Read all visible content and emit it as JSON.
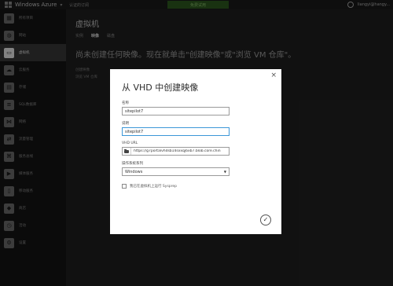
{
  "topbar": {
    "brand": "Windows Azure",
    "subscription": "认证的订阅",
    "credit": "免费试用",
    "user_email": "liangyi@hangy..."
  },
  "sidebar": {
    "items": [
      {
        "label": "所有项目",
        "icon": "grid-icon",
        "active": false
      },
      {
        "label": "网站",
        "icon": "globe-icon",
        "active": false
      },
      {
        "label": "虚拟机",
        "icon": "monitor-icon",
        "active": true
      },
      {
        "label": "云服务",
        "icon": "cloud-icon",
        "active": false
      },
      {
        "label": "存储",
        "icon": "storage-icon",
        "active": false
      },
      {
        "label": "SQL数据库",
        "icon": "database-icon",
        "active": false
      },
      {
        "label": "网络",
        "icon": "network-icon",
        "active": false
      },
      {
        "label": "流量管理",
        "icon": "traffic-icon",
        "active": false
      },
      {
        "label": "服务总线",
        "icon": "bus-icon",
        "active": false
      },
      {
        "label": "媒体服务",
        "icon": "media-icon",
        "active": false
      },
      {
        "label": "移动服务",
        "icon": "mobile-icon",
        "active": false
      },
      {
        "label": "商店",
        "icon": "store-icon",
        "active": false
      },
      {
        "label": "活动",
        "icon": "activity-icon",
        "active": false
      },
      {
        "label": "设置",
        "icon": "gear-icon",
        "active": false
      }
    ]
  },
  "main": {
    "title": "虚拟机",
    "tabs": [
      "实例",
      "映像",
      "磁盘"
    ],
    "empty_message": "尚未创建任何映像。现在就单击\"创建映像\"或\"浏览 VM 仓库\"。",
    "link1": "创建映像",
    "link2": "浏览 VM 仓库"
  },
  "dialog": {
    "title": "从 VHD 中创建映像",
    "name_label": "名称",
    "name_value": "sitepilot7",
    "desc_label": "说明",
    "desc_value": "sitepilot7",
    "url_label": "VHD URL",
    "url_value": "https://g7portalvhdsb14sxxqj6xb7.blob.core.chin",
    "os_label": "操作系统系列",
    "os_value": "Windows",
    "checkbox_label": "我已在虚拟机上运行 Sysprep",
    "close_symbol": "×",
    "confirm_symbol": "✓"
  }
}
